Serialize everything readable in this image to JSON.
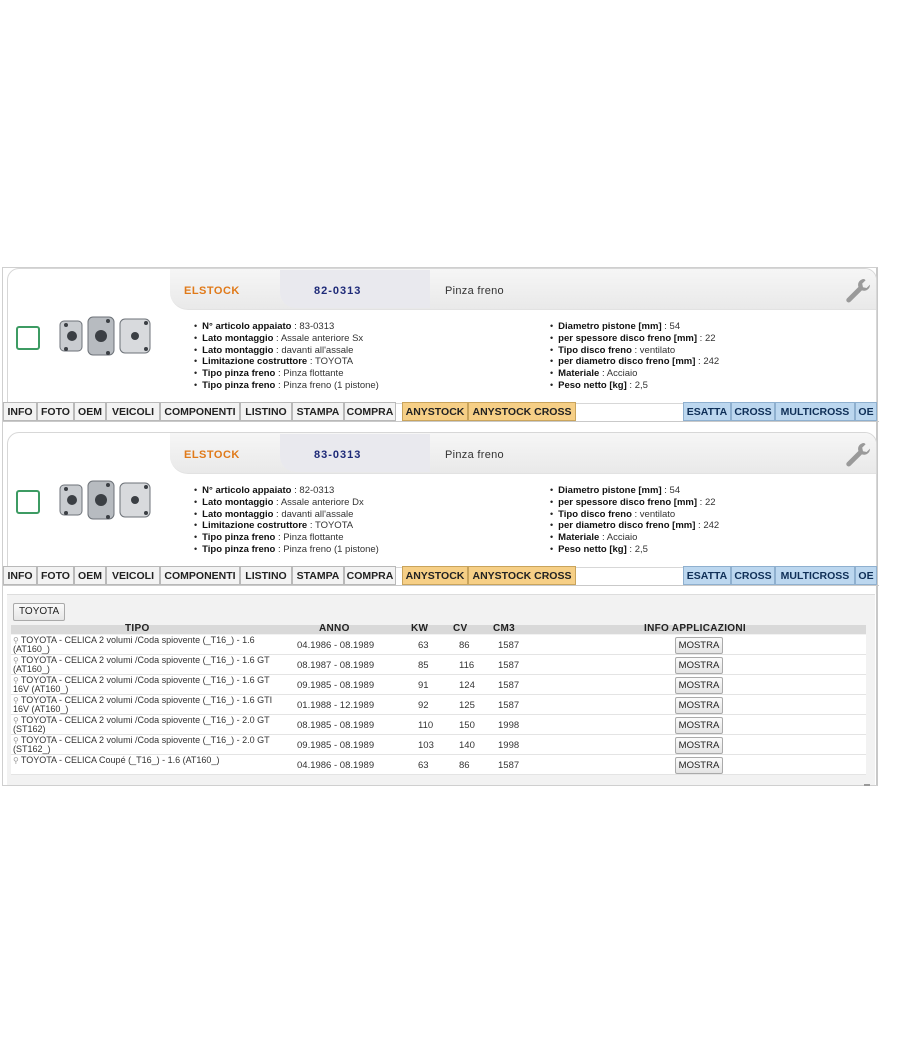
{
  "cards": [
    {
      "brand": "ELSTOCK",
      "code": "82-0313",
      "description": "Pinza freno",
      "specs_left": [
        {
          "label": "N° articolo appaiato",
          "value": "83-0313"
        },
        {
          "label": "Lato montaggio",
          "value": "Assale anteriore Sx"
        },
        {
          "label": "Lato montaggio",
          "value": "davanti all'assale"
        },
        {
          "label": "Limitazione costruttore",
          "value": "TOYOTA"
        },
        {
          "label": "Tipo pinza freno",
          "value": "Pinza flottante"
        },
        {
          "label": "Tipo pinza freno",
          "value": "Pinza freno (1 pistone)"
        }
      ],
      "specs_right": [
        {
          "label": "Diametro pistone [mm]",
          "value": "54"
        },
        {
          "label": "per spessore disco freno [mm]",
          "value": "22"
        },
        {
          "label": "Tipo disco freno",
          "value": "ventilato"
        },
        {
          "label": "per diametro disco freno [mm]",
          "value": "242"
        },
        {
          "label": "Materiale",
          "value": "Acciaio"
        },
        {
          "label": "Peso netto [kg]",
          "value": "2,5"
        }
      ]
    },
    {
      "brand": "ELSTOCK",
      "code": "83-0313",
      "description": "Pinza freno",
      "specs_left": [
        {
          "label": "N° articolo appaiato",
          "value": "82-0313"
        },
        {
          "label": "Lato montaggio",
          "value": "Assale anteriore Dx"
        },
        {
          "label": "Lato montaggio",
          "value": "davanti all'assale"
        },
        {
          "label": "Limitazione costruttore",
          "value": "TOYOTA"
        },
        {
          "label": "Tipo pinza freno",
          "value": "Pinza flottante"
        },
        {
          "label": "Tipo pinza freno",
          "value": "Pinza freno (1 pistone)"
        }
      ],
      "specs_right": [
        {
          "label": "Diametro pistone [mm]",
          "value": "54"
        },
        {
          "label": "per spessore disco freno [mm]",
          "value": "22"
        },
        {
          "label": "Tipo disco freno",
          "value": "ventilato"
        },
        {
          "label": "per diametro disco freno [mm]",
          "value": "242"
        },
        {
          "label": "Materiale",
          "value": "Acciaio"
        },
        {
          "label": "Peso netto [kg]",
          "value": "2,5"
        }
      ]
    }
  ],
  "tabs": [
    {
      "label": "INFO",
      "style": "plain"
    },
    {
      "label": "FOTO",
      "style": "plain"
    },
    {
      "label": "OEM",
      "style": "plain"
    },
    {
      "label": "VEICOLI",
      "style": "plain"
    },
    {
      "label": "COMPONENTI",
      "style": "plain"
    },
    {
      "label": "LISTINO",
      "style": "plain"
    },
    {
      "label": "STAMPA",
      "style": "plain"
    },
    {
      "label": "COMPRA",
      "style": "plain"
    },
    {
      "label": "ANYSTOCK",
      "style": "orange"
    },
    {
      "label": "ANYSTOCK CROSS",
      "style": "orange"
    },
    {
      "label": "ESATTA",
      "style": "blue"
    },
    {
      "label": "CROSS",
      "style": "blue"
    },
    {
      "label": "MULTICROSS",
      "style": "blue"
    },
    {
      "label": "OE",
      "style": "blue"
    }
  ],
  "applications": {
    "filter_button": "TOYOTA",
    "headers": {
      "tipo": "TIPO",
      "anno": "ANNO",
      "kw": "KW",
      "cv": "CV",
      "cm3": "CM3",
      "info": "INFO APPLICAZIONI"
    },
    "button_label": "MOSTRA",
    "rows": [
      {
        "tipo": "TOYOTA - CELICA 2 volumi /Coda spiovente (_T16_) - 1.6 (AT160_)",
        "anno": "04.1986 - 08.1989",
        "kw": "63",
        "cv": "86",
        "cm3": "1587"
      },
      {
        "tipo": "TOYOTA - CELICA 2 volumi /Coda spiovente (_T16_) - 1.6 GT (AT160_)",
        "anno": "08.1987 - 08.1989",
        "kw": "85",
        "cv": "116",
        "cm3": "1587"
      },
      {
        "tipo": "TOYOTA - CELICA 2 volumi /Coda spiovente (_T16_) - 1.6 GT 16V (AT160_)",
        "anno": "09.1985 - 08.1989",
        "kw": "91",
        "cv": "124",
        "cm3": "1587"
      },
      {
        "tipo": "TOYOTA - CELICA 2 volumi /Coda spiovente (_T16_) - 1.6 GTI 16V (AT160_)",
        "anno": "01.1988 - 12.1989",
        "kw": "92",
        "cv": "125",
        "cm3": "1587"
      },
      {
        "tipo": "TOYOTA - CELICA 2 volumi /Coda spiovente (_T16_) - 2.0 GT (ST162)",
        "anno": "08.1985 - 08.1989",
        "kw": "110",
        "cv": "150",
        "cm3": "1998"
      },
      {
        "tipo": "TOYOTA - CELICA 2 volumi /Coda spiovente (_T16_) - 2.0 GT (ST162_)",
        "anno": "09.1985 - 08.1989",
        "kw": "103",
        "cv": "140",
        "cm3": "1998"
      },
      {
        "tipo": "TOYOTA - CELICA Coupé (_T16_) - 1.6 (AT160_)",
        "anno": "04.1986 - 08.1989",
        "kw": "63",
        "cv": "86",
        "cm3": "1587"
      }
    ]
  },
  "colors": {
    "brand": "#e07a1a",
    "code": "#1e2a78",
    "checkbox": "#3d9b63",
    "tab_orange": "#f6cf86",
    "tab_blue": "#bcd7ef"
  }
}
